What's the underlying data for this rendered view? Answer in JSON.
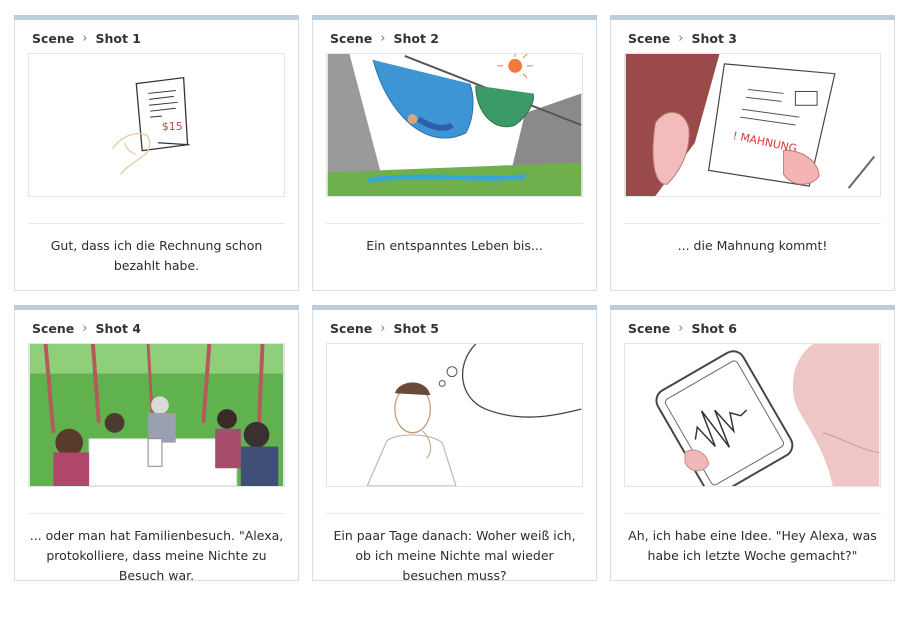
{
  "breadcrumb_root": "Scene",
  "shots": [
    {
      "label": "Shot 1",
      "caption": "Gut, dass ich die Rechnung schon bezahlt habe.",
      "sketch_text": "$15"
    },
    {
      "label": "Shot 2",
      "caption": "Ein entspanntes Leben bis..."
    },
    {
      "label": "Shot 3",
      "caption": "... die Mahnung kommt!",
      "sketch_text": "! MAHNUNG"
    },
    {
      "label": "Shot 4",
      "caption": "... oder man hat Familienbesuch. \"Alexa, protokolliere, dass meine Nichte zu Besuch war."
    },
    {
      "label": "Shot 5",
      "caption": "Ein paar Tage danach: Woher weiß ich, ob ich meine Nichte mal wieder besuchen muss?"
    },
    {
      "label": "Shot 6",
      "caption": "Ah, ich habe eine Idee. \"Hey Alexa, was habe ich letzte Woche gemacht?\""
    }
  ],
  "colors": {
    "accent_bar": "#bccddd",
    "border": "#d6dee6"
  }
}
